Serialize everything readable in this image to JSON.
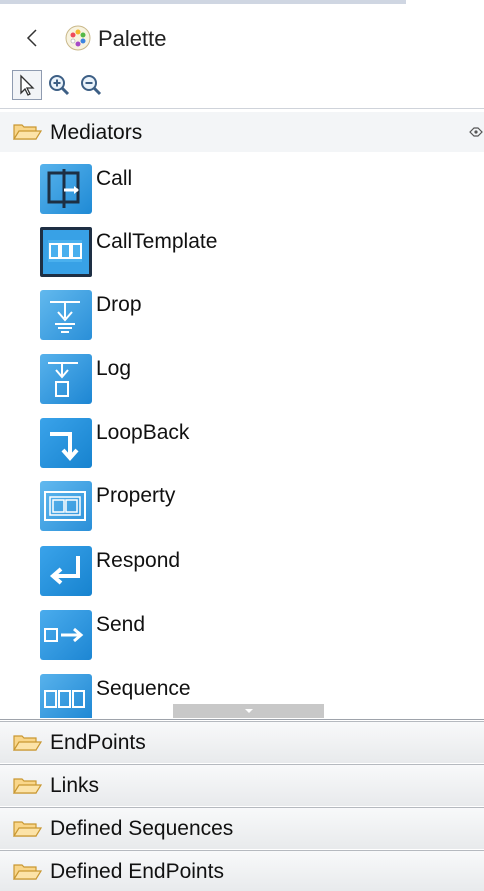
{
  "palette": {
    "title": "Palette",
    "icons": {
      "collapse": "collapse-left-arrow-icon",
      "logo": "palette-icon",
      "select": "selection-arrow-icon",
      "zoom_in": "zoom-in-icon",
      "zoom_out": "zoom-out-icon"
    }
  },
  "drawers": {
    "mediators": {
      "label": "Mediators",
      "items": [
        {
          "label": "Call",
          "icon": "call-icon"
        },
        {
          "label": "CallTemplate",
          "icon": "call-template-icon"
        },
        {
          "label": "Drop",
          "icon": "drop-icon"
        },
        {
          "label": "Log",
          "icon": "log-icon"
        },
        {
          "label": "LoopBack",
          "icon": "loopback-icon"
        },
        {
          "label": "Property",
          "icon": "property-icon"
        },
        {
          "label": "Respond",
          "icon": "respond-icon"
        },
        {
          "label": "Send",
          "icon": "send-icon"
        },
        {
          "label": "Sequence",
          "icon": "sequence-icon"
        }
      ]
    },
    "endpoints": {
      "label": "EndPoints"
    },
    "links": {
      "label": "Links"
    },
    "defined_sequences": {
      "label": "Defined Sequences"
    },
    "defined_endpoints": {
      "label": "Defined EndPoints"
    }
  },
  "colors": {
    "mediator_blue": "#3b9ee0",
    "mediator_blue_dark": "#177fc9",
    "folder": "#f4c562",
    "header_line": "#cfd6e2"
  }
}
